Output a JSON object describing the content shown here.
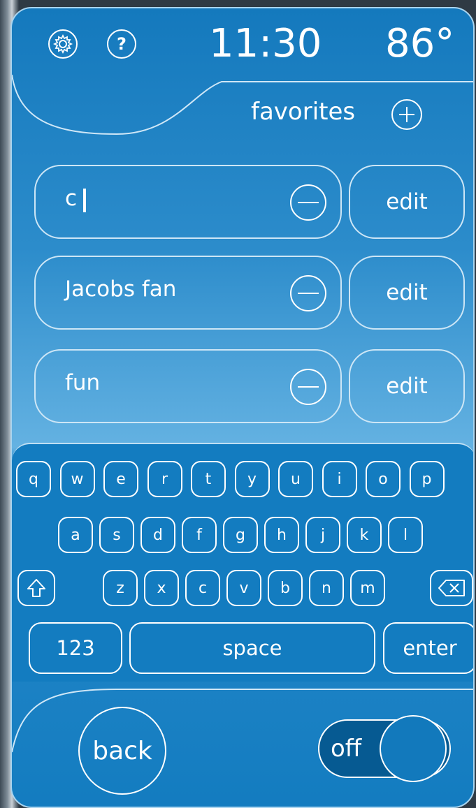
{
  "header": {
    "time": "11:30",
    "temperature": "86°",
    "favorites_label": "favorites"
  },
  "favorites": [
    {
      "name": "c",
      "edit_label": "edit"
    },
    {
      "name": "Jacobs fan",
      "edit_label": "edit"
    },
    {
      "name": "fun",
      "edit_label": "edit"
    }
  ],
  "keyboard": {
    "row1": [
      "q",
      "w",
      "e",
      "r",
      "t",
      "y",
      "u",
      "i",
      "o",
      "p"
    ],
    "row2": [
      "a",
      "s",
      "d",
      "f",
      "g",
      "h",
      "j",
      "k",
      "l"
    ],
    "row3": [
      "z",
      "x",
      "c",
      "v",
      "b",
      "n",
      "m"
    ],
    "numbers_label": "123",
    "space_label": "space",
    "enter_label": "enter"
  },
  "footer": {
    "back_label": "back",
    "toggle_label": "off"
  }
}
